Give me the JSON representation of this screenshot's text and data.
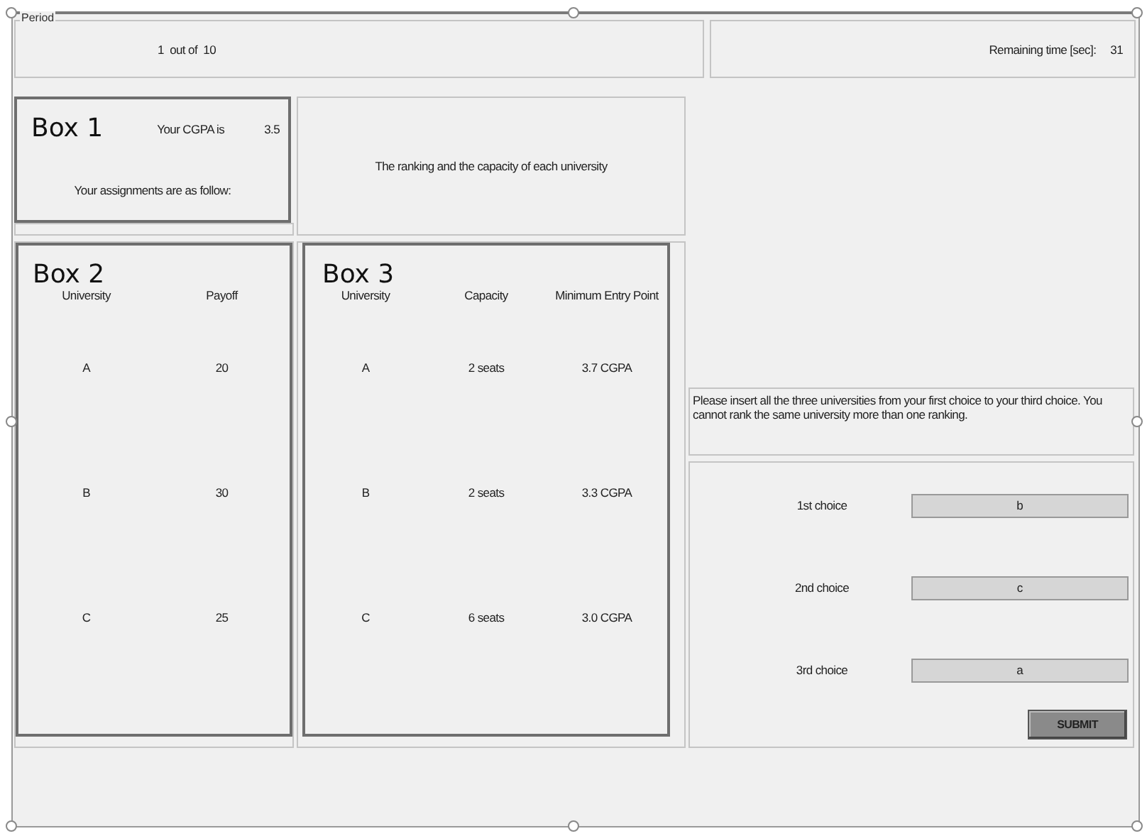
{
  "period": {
    "legend": "Period",
    "current": "1",
    "separator": "out of",
    "total": "10"
  },
  "timer": {
    "label": "Remaining time [sec]:",
    "value": "31"
  },
  "box1": {
    "title": "Box 1",
    "cgpa_label": "Your CGPA is",
    "cgpa": "3.5",
    "assignments_label": "Your assignments are as follow:"
  },
  "ranking_header": "The ranking and the capacity of each university",
  "box2": {
    "title": "Box 2",
    "columns": [
      "University",
      "Payoff"
    ],
    "rows": [
      [
        "A",
        "20"
      ],
      [
        "B",
        "30"
      ],
      [
        "C",
        "25"
      ]
    ]
  },
  "box3": {
    "title": "Box 3",
    "columns": [
      "University",
      "Capacity",
      "Minimum Entry Point"
    ],
    "rows": [
      [
        "A",
        "2 seats",
        "3.7 CGPA"
      ],
      [
        "B",
        "2 seats",
        "3.3 CGPA"
      ],
      [
        "C",
        "6 seats",
        "3.0 CGPA"
      ]
    ]
  },
  "instructions": "Please insert all the three universities from your first choice to your third choice. You cannot rank the same university more than one ranking.",
  "choices": [
    {
      "label": "1st choice",
      "value": "b"
    },
    {
      "label": "2nd choice",
      "value": "c"
    },
    {
      "label": "3rd choice",
      "value": "a"
    }
  ],
  "submit": "SUBMIT"
}
